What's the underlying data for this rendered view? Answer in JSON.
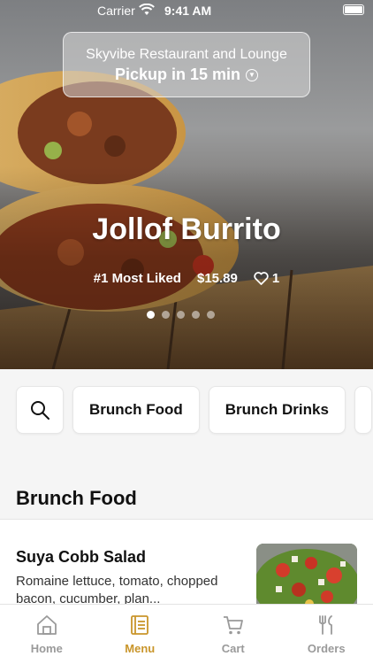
{
  "status_bar": {
    "carrier": "Carrier",
    "time": "9:41 AM"
  },
  "pickup": {
    "restaurant": "Skyvibe Restaurant and Lounge",
    "status": "Pickup in 15 min"
  },
  "hero": {
    "title": "Jollof Burrito",
    "rank": "#1 Most Liked",
    "price": "$15.89",
    "likes": "1",
    "slides": 5,
    "active_slide": 1
  },
  "categories": {
    "chips": [
      "Brunch Food",
      "Brunch Drinks"
    ]
  },
  "section": {
    "title": "Brunch Food"
  },
  "menu_item": {
    "name": "Suya Cobb Salad",
    "description": "Romaine lettuce, tomato, chopped bacon, cucumber, plan..."
  },
  "tabbar": {
    "tabs": [
      {
        "label": "Home",
        "icon": "home-icon"
      },
      {
        "label": "Menu",
        "icon": "menu-book-icon"
      },
      {
        "label": "Cart",
        "icon": "cart-icon"
      },
      {
        "label": "Orders",
        "icon": "fork-knife-icon"
      }
    ],
    "active": "Menu",
    "active_color": "#c9952a",
    "inactive_color": "#9a9a9a"
  }
}
